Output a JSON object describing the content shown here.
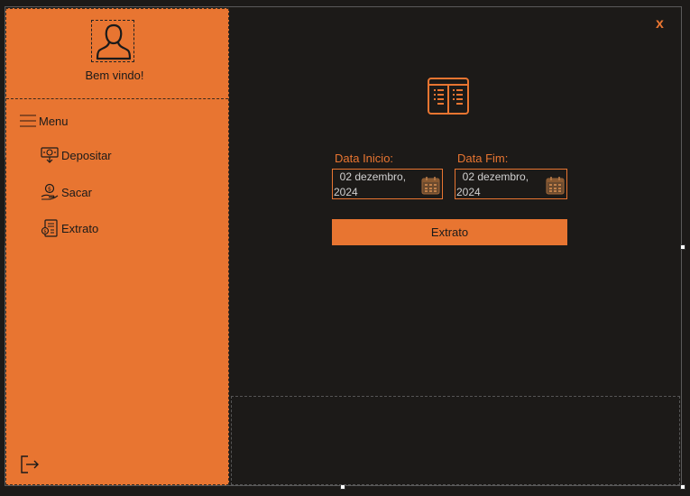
{
  "sidebar": {
    "welcome": "Bem vindo!",
    "menu_label": "Menu",
    "items": [
      {
        "label": "Depositar",
        "icon": "deposit-money-icon"
      },
      {
        "label": "Sacar",
        "icon": "withdraw-hand-coin-icon"
      },
      {
        "label": "Extrato",
        "icon": "statement-icon"
      }
    ],
    "logout_icon": "logout-icon"
  },
  "window": {
    "close_label": "x"
  },
  "main": {
    "icon": "statement-book-icon",
    "start_date_label": "Data Inicio:",
    "start_date_value": "  02 dezembro,\n2024",
    "end_date_label": "Data Fim:",
    "end_date_value": "  02 dezembro,\n2024",
    "extrato_button": "Extrato"
  },
  "colors": {
    "accent": "#e87531",
    "background": "#1c1a18",
    "text_dark": "#1a1a1a"
  }
}
